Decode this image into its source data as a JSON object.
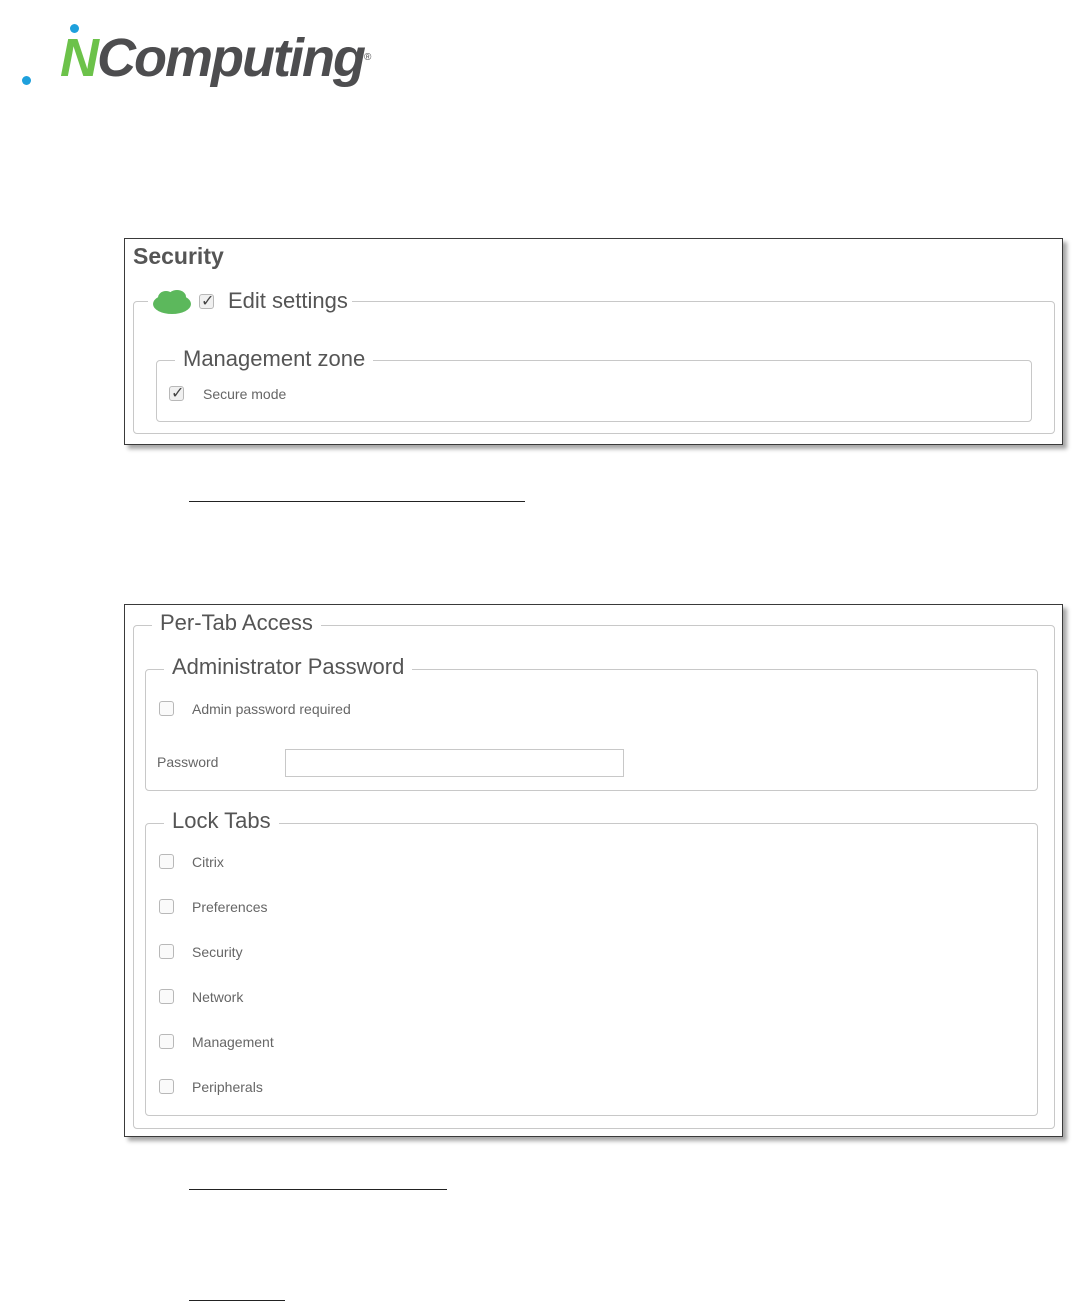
{
  "logo": {
    "text_n": "N",
    "text_rest": "Computing",
    "registered": "®"
  },
  "security_panel": {
    "title": "Security",
    "edit_legend": "Edit settings",
    "edit_checked": true,
    "zone_legend": "Management zone",
    "secure_mode_label": "Secure mode",
    "secure_mode_checked": true
  },
  "per_tab_panel": {
    "legend": "Per-Tab Access",
    "admin": {
      "legend": "Administrator Password",
      "required_label": "Admin password required",
      "required_checked": false,
      "password_label": "Password",
      "password_value": ""
    },
    "lock_tabs": {
      "legend": "Lock Tabs",
      "items": [
        {
          "label": "Citrix",
          "checked": false
        },
        {
          "label": "Preferences",
          "checked": false
        },
        {
          "label": "Security",
          "checked": false
        },
        {
          "label": "Network",
          "checked": false
        },
        {
          "label": "Management",
          "checked": false
        },
        {
          "label": "Peripherals",
          "checked": false
        }
      ]
    }
  },
  "colors": {
    "brand_green": "#6cc24a",
    "brand_gray": "#4d4d4f",
    "brand_blue": "#1ea0dc",
    "cloud_green": "#5cb85c"
  }
}
